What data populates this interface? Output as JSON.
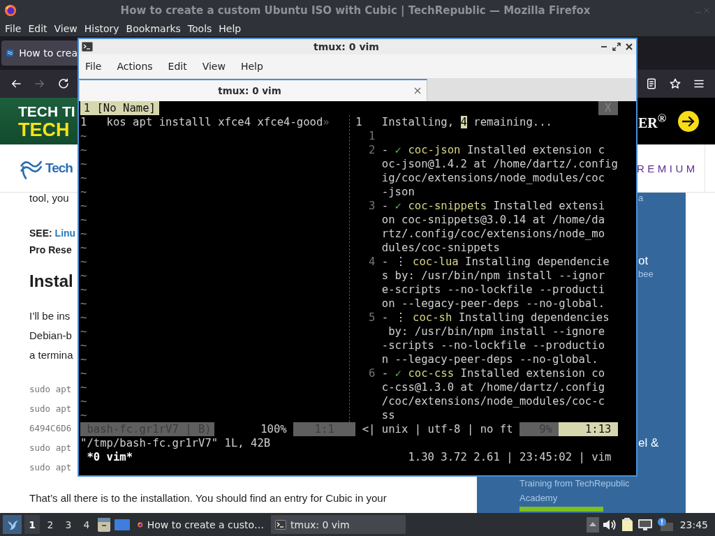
{
  "browser": {
    "title": "How to create a custom Ubuntu ISO with Cubic | TechRepublic — Mozilla Firefox",
    "menu": [
      "File",
      "Edit",
      "View",
      "History",
      "Bookmarks",
      "Tools",
      "Help"
    ],
    "tab": {
      "label": "How to crea",
      "selected": true
    },
    "banner": {
      "line_1": "TECH TI",
      "line_2": "TECH",
      "right_text": "ER$^{®}$"
    },
    "header": {
      "logo_text": "Tech",
      "premium": "REMIUM"
    },
    "article": [
      {
        "kind": "paragraph",
        "lines": [
          "tool, you"
        ]
      },
      {
        "kind": "see",
        "label": "SEE:",
        "link": "Linu",
        "lines": [
          "Pro Rese"
        ]
      },
      {
        "kind": "heading",
        "lines": [
          "Instal"
        ]
      },
      {
        "kind": "paragraph",
        "lines": [
          "I’ll be ins",
          "Debian-b",
          "a termina"
        ]
      },
      {
        "kind": "code",
        "lines": [
          "sudo apt",
          "sudo apt",
          "6494C6D6",
          "sudo apt",
          "sudo apt"
        ]
      },
      {
        "kind": "paragraph",
        "lines": [
          "That’s all there is to the installation. You should find an entry for Cubic in your"
        ]
      }
    ],
    "sidebar": [
      {
        "lines": [
          {
            "kind": "caption",
            "text": "a"
          }
        ]
      },
      {
        "lines": [
          {
            "kind": "title",
            "text": "ot"
          },
          {
            "kind": "caption",
            "text": "bee"
          }
        ]
      },
      {
        "lines": [
          {
            "kind": "title",
            "text": "el &"
          }
        ]
      },
      {
        "lines": [
          {
            "kind": "caption",
            "text": "Training from TechRepublic"
          },
          {
            "kind": "caption",
            "text": "Academy"
          }
        ],
        "button": true
      }
    ]
  },
  "terminal": {
    "title": "tmux: 0 vim",
    "menu": [
      "File",
      "Actions",
      "Edit",
      "View",
      "Help"
    ],
    "tab": {
      "label": "tmux: 0 vim",
      "selected": true
    },
    "tabline": {
      "buffer": "1 [No Name]",
      "close": "X"
    },
    "left_pane": {
      "lines": [
        {
          "num": "1",
          "text": "kos apt installl xfce4 xfce4-good",
          "overflow": "»"
        }
      ],
      "empty_lines": [
        "~",
        "~",
        "~",
        "~",
        "~",
        "~",
        "~",
        "~",
        "~",
        "~",
        "~",
        "~",
        "~",
        "~",
        "~",
        "~",
        "~",
        "~",
        "~",
        "~",
        "~"
      ]
    },
    "right_pane": [
      {
        "num": "1",
        "current": true,
        "segments": [
          {
            "kind": "text",
            "text": "Installing, "
          },
          {
            "kind": "cursor",
            "text": "4"
          },
          {
            "kind": "text",
            "text": " remaining..."
          }
        ]
      },
      {
        "num": "1",
        "current": false
      },
      {
        "num": "2",
        "current": false,
        "segments": [
          {
            "kind": "text",
            "text": "- "
          },
          {
            "kind": "check",
            "text": "✓"
          },
          {
            "kind": "name",
            "text": " coc-json"
          },
          {
            "kind": "text",
            "text": " Installed extension c"
          }
        ]
      },
      {
        "segments": [
          {
            "kind": "text",
            "text": "oc-json@1.4.2 at /home/dartz/.config"
          }
        ]
      },
      {
        "segments": [
          {
            "kind": "text",
            "text": "ig/coc/extensions/node_modules/coc"
          }
        ]
      },
      {
        "segments": [
          {
            "kind": "text",
            "text": "-json"
          }
        ]
      },
      {
        "num": "3",
        "current": false,
        "segments": [
          {
            "kind": "text",
            "text": "- "
          },
          {
            "kind": "check",
            "text": "✓"
          },
          {
            "kind": "name",
            "text": " coc-snippets"
          },
          {
            "kind": "text",
            "text": " Installed extensi"
          }
        ]
      },
      {
        "segments": [
          {
            "kind": "text",
            "text": "on coc-snippets@3.0.14 at /home/da"
          }
        ]
      },
      {
        "segments": [
          {
            "kind": "text",
            "text": "rtz/.config/coc/extensions/node_mo"
          }
        ]
      },
      {
        "segments": [
          {
            "kind": "text",
            "text": "dules/coc-snippets"
          }
        ]
      },
      {
        "num": "4",
        "current": false,
        "segments": [
          {
            "kind": "text",
            "text": "- "
          },
          {
            "kind": "spinner",
            "text": "⋮"
          },
          {
            "kind": "name",
            "text": " coc-lua"
          },
          {
            "kind": "text",
            "text": " Installing dependencie"
          }
        ]
      },
      {
        "segments": [
          {
            "kind": "text",
            "text": "s by: /usr/bin/npm install --ignor"
          }
        ]
      },
      {
        "segments": [
          {
            "kind": "text",
            "text": "e-scripts --no-lockfile --producti"
          }
        ]
      },
      {
        "segments": [
          {
            "kind": "text",
            "text": "on --legacy-peer-deps --no-global."
          }
        ]
      },
      {
        "num": "5",
        "current": false,
        "segments": [
          {
            "kind": "text",
            "text": "- "
          },
          {
            "kind": "spinner",
            "text": "⋮"
          },
          {
            "kind": "name",
            "text": " coc-sh"
          },
          {
            "kind": "text",
            "text": " Installing dependencies"
          }
        ]
      },
      {
        "segments": [
          {
            "kind": "text",
            "text": " by: /usr/bin/npm install --ignore"
          }
        ]
      },
      {
        "segments": [
          {
            "kind": "text",
            "text": "-scripts --no-lockfile --productio"
          }
        ]
      },
      {
        "segments": [
          {
            "kind": "text",
            "text": "n --legacy-peer-deps --no-global."
          }
        ]
      },
      {
        "num": "6",
        "current": false,
        "segments": [
          {
            "kind": "text",
            "text": "- "
          },
          {
            "kind": "check",
            "text": "✓"
          },
          {
            "kind": "name",
            "text": " coc-css"
          },
          {
            "kind": "text",
            "text": " Installed extension co"
          }
        ]
      },
      {
        "segments": [
          {
            "kind": "text",
            "text": "c-css@1.3.0 at /home/dartz/.config"
          }
        ]
      },
      {
        "segments": [
          {
            "kind": "text",
            "text": "/coc/extensions/node_modules/coc-c"
          }
        ]
      },
      {
        "segments": [
          {
            "kind": "text",
            "text": "ss"
          }
        ]
      }
    ],
    "statusline": [
      {
        "kind": "inactive",
        "text": "bash-fc.gr1rV7 | B)"
      },
      {
        "kind": "plain",
        "text": "100%"
      },
      {
        "kind": "inactive",
        "text": "1:1"
      },
      {
        "kind": "plain",
        "text": "<| unix | utf-8 | no ft"
      },
      {
        "kind": "inactive",
        "text": "9%"
      },
      {
        "kind": "active",
        "text": "1:13"
      }
    ],
    "cmdline": "\"/tmp/bash-fc.gr1rV7\" 1L, 42B",
    "tmux": {
      "window": "*0 vim*",
      "right": "1.30 3.72 2.61 | 23:45:02 | vim"
    }
  },
  "taskbar": {
    "workspaces": [
      {
        "label": "1",
        "selected": true
      },
      {
        "label": "2",
        "selected": false
      },
      {
        "label": "3",
        "selected": false
      },
      {
        "label": "4",
        "selected": false
      }
    ],
    "tasks": [
      {
        "kind": "browser",
        "label": "How to create a custo…",
        "selected": false
      },
      {
        "kind": "terminal",
        "label": "tmux: 0 vim",
        "selected": true
      }
    ],
    "clock": "23:45"
  }
}
